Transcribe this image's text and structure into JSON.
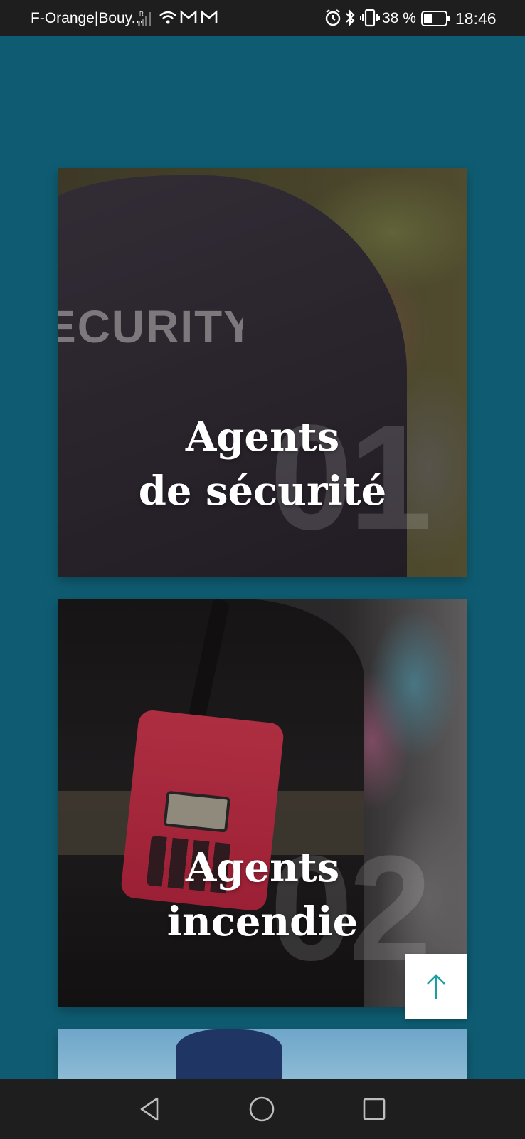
{
  "status_bar": {
    "carrier": "F-Orange|Bouy...",
    "battery_percent": "38 %",
    "battery_level": 0.38,
    "time": "18:46",
    "icons": [
      "signal-icon",
      "wifi-icon",
      "gmail-icon",
      "gmail-icon",
      "alarm-icon",
      "bluetooth-icon",
      "vibrate-icon",
      "battery-icon"
    ]
  },
  "services": [
    {
      "number": "01",
      "title_line1": "Agents",
      "title_line2": "de sécurité"
    },
    {
      "number": "02",
      "title_line1": "Agents",
      "title_line2": "incendie"
    }
  ],
  "back_to_top": {
    "icon": "arrow-up-icon",
    "color": "#1aa0a0"
  },
  "colors": {
    "page_background": "#0f5c72",
    "system_bars": "#1e1e1e"
  },
  "nav_bar": {
    "icons": [
      "back-icon",
      "home-icon",
      "recents-icon"
    ]
  }
}
